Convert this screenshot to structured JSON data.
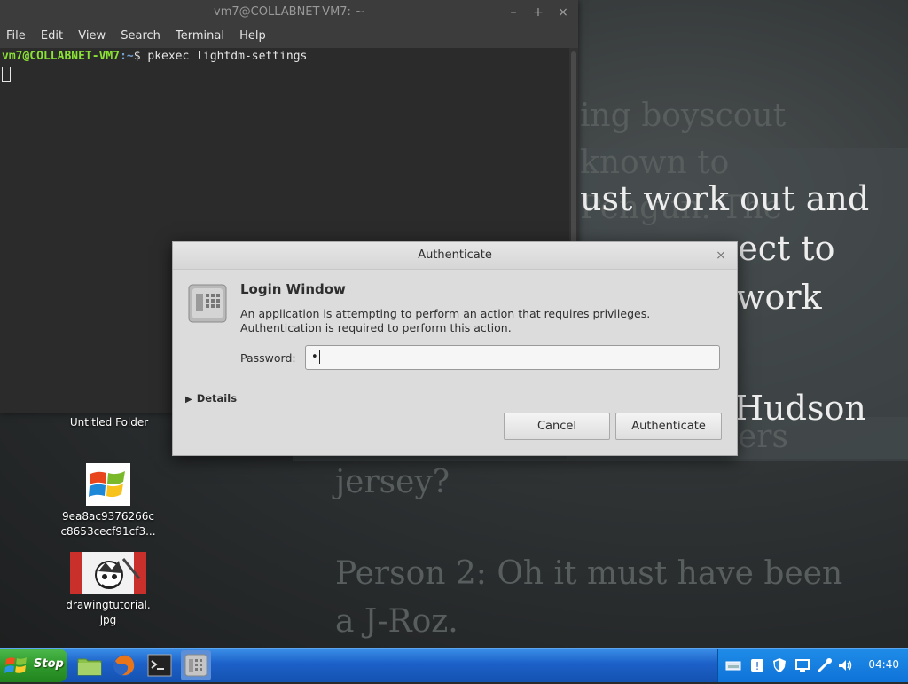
{
  "terminal": {
    "title": "vm7@COLLABNET-VM7: ~",
    "menu": [
      "File",
      "Edit",
      "View",
      "Search",
      "Terminal",
      "Help"
    ],
    "prompt_user": "vm7@COLLABNET-VM7",
    "prompt_path": ":~",
    "prompt_symbol": "$",
    "command": " pkexec lightdm-settings"
  },
  "auth_dialog": {
    "title": "Authenticate",
    "heading": "Login Window",
    "message": "An application is attempting to perform an action that requires privileges. Authentication is required to perform this action.",
    "password_label": "Password:",
    "password_value": "•",
    "details_label": "Details",
    "cancel_label": "Cancel",
    "authenticate_label": "Authenticate"
  },
  "wallpaper": {
    "lines_dim": [
      "ing boyscout",
      "known to",
      "Pengun. The",
      "ers",
      "jersey?",
      "Person 2: Oh it must have been",
      "a J-Roz."
    ],
    "lines_bright": [
      "ust work out and",
      "expect to",
      "work",
      "Hudson"
    ]
  },
  "desktop_icons": [
    {
      "label": "Untitled Folder"
    },
    {
      "label": "9ea8ac9376266c c8653cecf91cf3..."
    },
    {
      "label": "drawingtutorial.\njpg"
    }
  ],
  "taskbar": {
    "start_label": "Stop",
    "clock": "04:40"
  }
}
